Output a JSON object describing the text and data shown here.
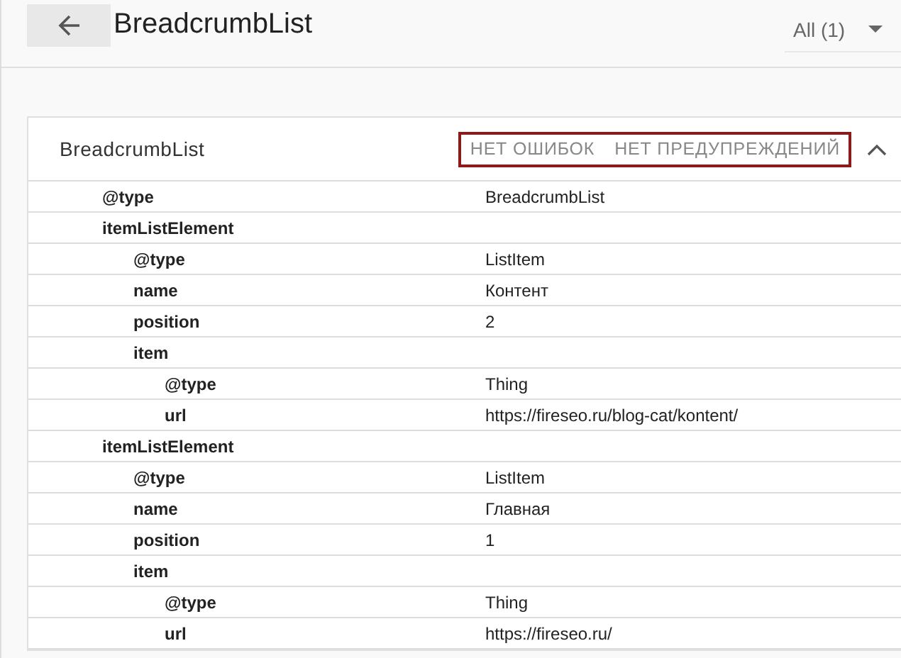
{
  "header": {
    "title": "BreadcrumbList",
    "filter": "All (1)"
  },
  "card": {
    "title": "BreadcrumbList",
    "expanded": true,
    "statuses": [
      "НЕТ ОШИБОК",
      "НЕТ ПРЕДУПРЕЖДЕНИЙ"
    ],
    "rows": [
      {
        "key": "@type",
        "value": "BreadcrumbList"
      },
      {
        "key": "itemListElement",
        "children": [
          {
            "key": "@type",
            "value": "ListItem"
          },
          {
            "key": "name",
            "value": "Контент"
          },
          {
            "key": "position",
            "value": "2"
          },
          {
            "key": "item",
            "children": [
              {
                "key": "@type",
                "value": "Thing"
              },
              {
                "key": "url",
                "value": "https://fireseo.ru/blog-cat/kontent/"
              }
            ]
          }
        ]
      },
      {
        "key": "itemListElement",
        "children": [
          {
            "key": "@type",
            "value": "ListItem"
          },
          {
            "key": "name",
            "value": "Главная"
          },
          {
            "key": "position",
            "value": "1"
          },
          {
            "key": "item",
            "children": [
              {
                "key": "@type",
                "value": "Thing"
              },
              {
                "key": "url",
                "value": "https://fireseo.ru/"
              }
            ]
          }
        ]
      }
    ]
  }
}
